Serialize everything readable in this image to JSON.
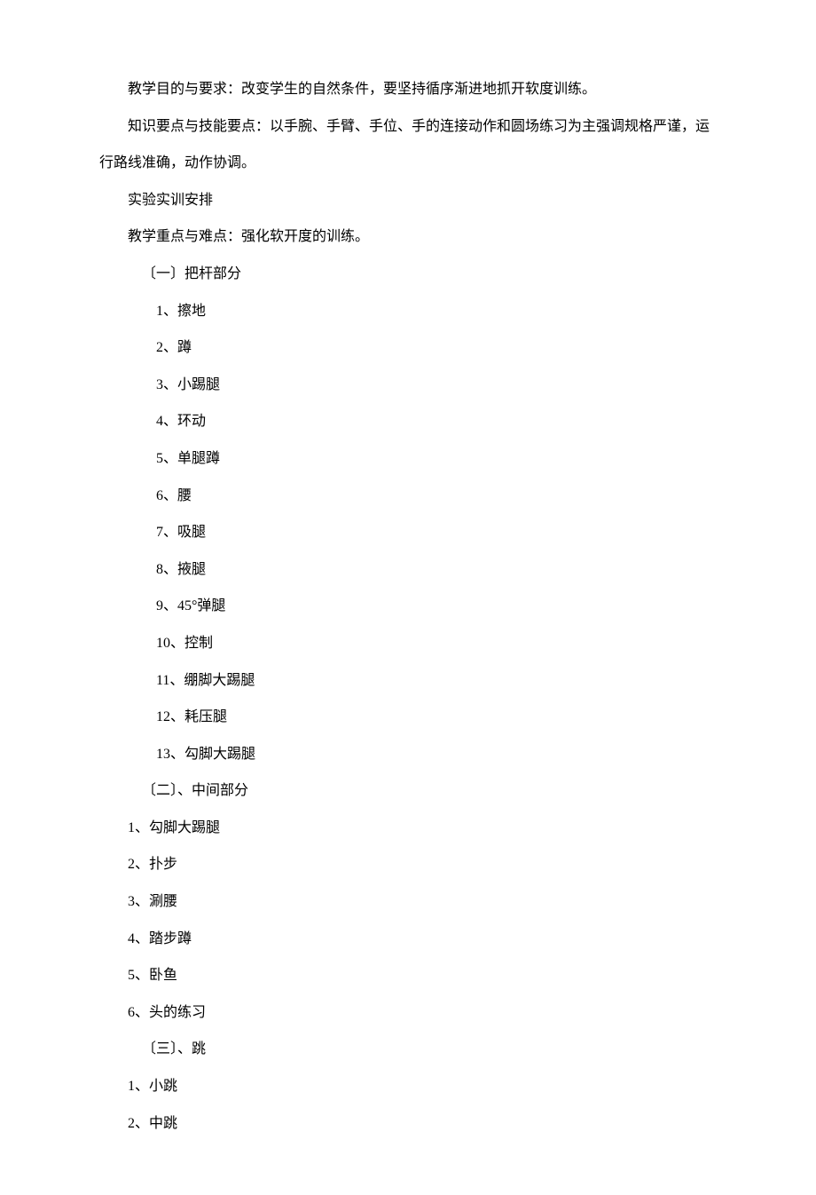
{
  "para1": "教学目的与要求：改变学生的自然条件，要坚持循序渐进地抓开软度训练。",
  "para2": "知识要点与技能要点：以手腕、手臂、手位、手的连接动作和圆场练习为主强调规格严谨，运行路线准确，动作协调。",
  "para3": "实验实训安排",
  "para4": "教学重点与难点：强化软开度的训练。",
  "section1": {
    "title": "〔一〕把杆部分",
    "items": [
      {
        "num": "1、",
        "text": "擦地"
      },
      {
        "num": "2、",
        "text": "蹲"
      },
      {
        "num": "3、",
        "text": "小踢腿"
      },
      {
        "num": "4、",
        "text": "环动"
      },
      {
        "num": "5、",
        "text": "单腿蹲"
      },
      {
        "num": "6、",
        "text": "腰"
      },
      {
        "num": "7、",
        "text": "吸腿"
      },
      {
        "num": "8、",
        "text": "掖腿"
      },
      {
        "num": "9、",
        "text": "45°弹腿"
      },
      {
        "num": "10、",
        "text": "控制"
      },
      {
        "num": "11、",
        "text": "绷脚大踢腿"
      },
      {
        "num": "12、",
        "text": "耗压腿"
      },
      {
        "num": "13、",
        "text": "勾脚大踢腿"
      }
    ]
  },
  "section2": {
    "title": "〔二〕、中间部分",
    "items": [
      "1、勾脚大踢腿",
      "2、扑步",
      "3、涮腰",
      "4、踏步蹲",
      "5、卧鱼",
      "6、头的练习"
    ]
  },
  "section3": {
    "title": "〔三〕、跳",
    "items": [
      "1、小跳",
      "2、中跳"
    ]
  }
}
